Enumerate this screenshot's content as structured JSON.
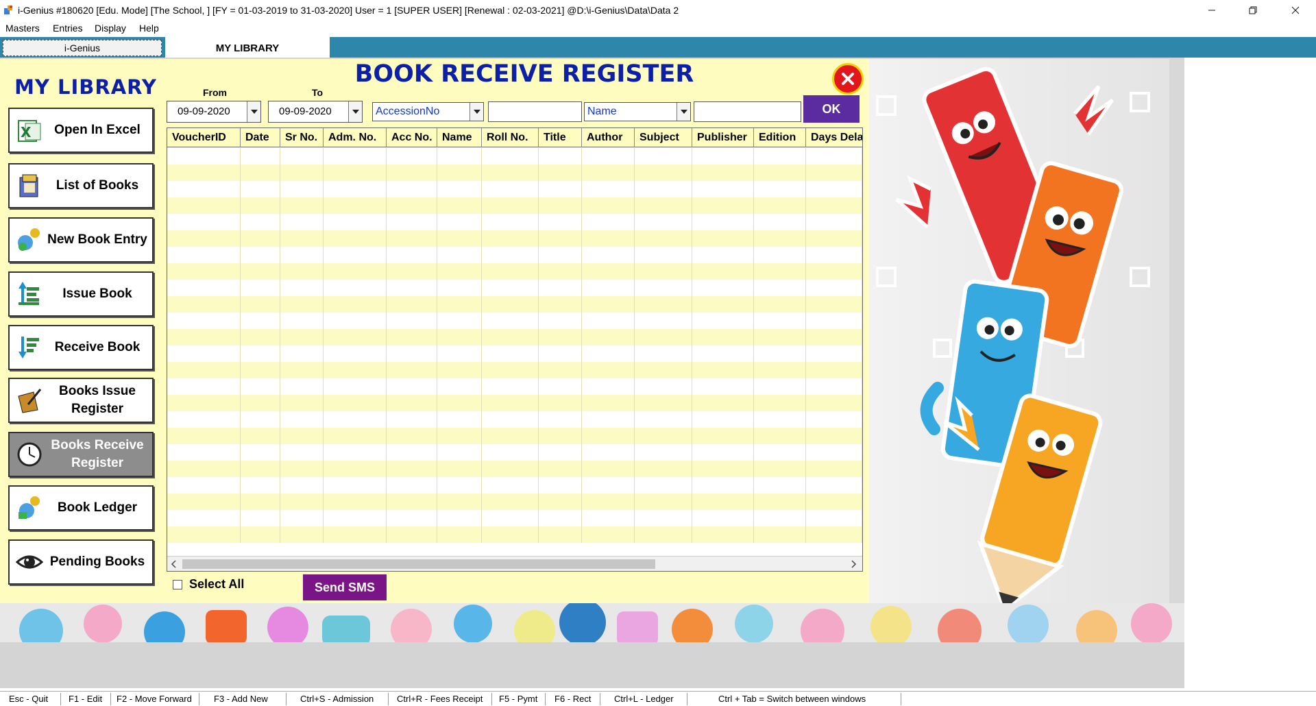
{
  "window": {
    "title": "i-Genius #180620  [Edu. Mode]  [The School, ] [FY = 01-03-2019 to 31-03-2020] User = 1 [SUPER USER]   [Renewal : 02-03-2021]  @D:\\i-Genius\\Data\\Data 2",
    "min_icon": "minimize-icon",
    "max_icon": "restore-icon",
    "close_icon": "close-icon"
  },
  "menu": {
    "items": [
      "Masters",
      "Entries",
      "Display",
      "Help"
    ]
  },
  "tabs": {
    "left": "i-Genius",
    "active": "MY LIBRARY"
  },
  "sidebar": {
    "title": "MY LIBRARY",
    "buttons": [
      {
        "label": "Open In Excel",
        "icon": "excel-icon"
      },
      {
        "label": "List of Books",
        "icon": "book-list-icon"
      },
      {
        "label": "New Book Entry",
        "icon": "new-entry-icon"
      },
      {
        "label": "Issue Book",
        "icon": "issue-icon"
      },
      {
        "label": "Receive Book",
        "icon": "receive-icon"
      },
      {
        "label": "Books Issue Register",
        "icon": "register-icon"
      },
      {
        "label": "Books Receive Register",
        "icon": "clock-icon"
      },
      {
        "label": "Book Ledger",
        "icon": "ledger-icon"
      },
      {
        "label": "Pending Books",
        "icon": "eye-icon"
      }
    ]
  },
  "form": {
    "title": "BOOK RECEIVE REGISTER",
    "from_label": "From",
    "to_label": "To",
    "from_date": "09-09-2020",
    "to_date": "09-09-2020",
    "filter1": "AccessionNo",
    "filter1_value": "",
    "filter2": "Name",
    "filter2_value": "",
    "ok_label": "OK",
    "columns": [
      "VoucherID",
      "Date",
      "Sr No.",
      "Adm. No.",
      "Acc No.",
      "Name",
      "Roll No.",
      "Title",
      "Author",
      "Subject",
      "Publisher",
      "Edition",
      "Days Delay"
    ],
    "select_all_label": "Select All",
    "select_all_checked": false,
    "send_sms_label": "Send SMS"
  },
  "statusbar": {
    "items": [
      "Esc - Quit",
      "F1 - Edit",
      "F2 - Move Forward",
      "F3 - Add New",
      "Ctrl+S - Admission",
      "Ctrl+R - Fees Receipt",
      "F5 - Pymt",
      "F6 - Rect",
      "Ctrl+L - Ledger",
      "Ctrl + Tab = Switch between windows"
    ]
  },
  "colors": {
    "form_bg": "#fffcbf",
    "title_blue": "#0b1fa8",
    "ok_purple": "#5a2ca0",
    "sms_purple": "#7a1587",
    "tab_blue": "#2e86ab"
  }
}
